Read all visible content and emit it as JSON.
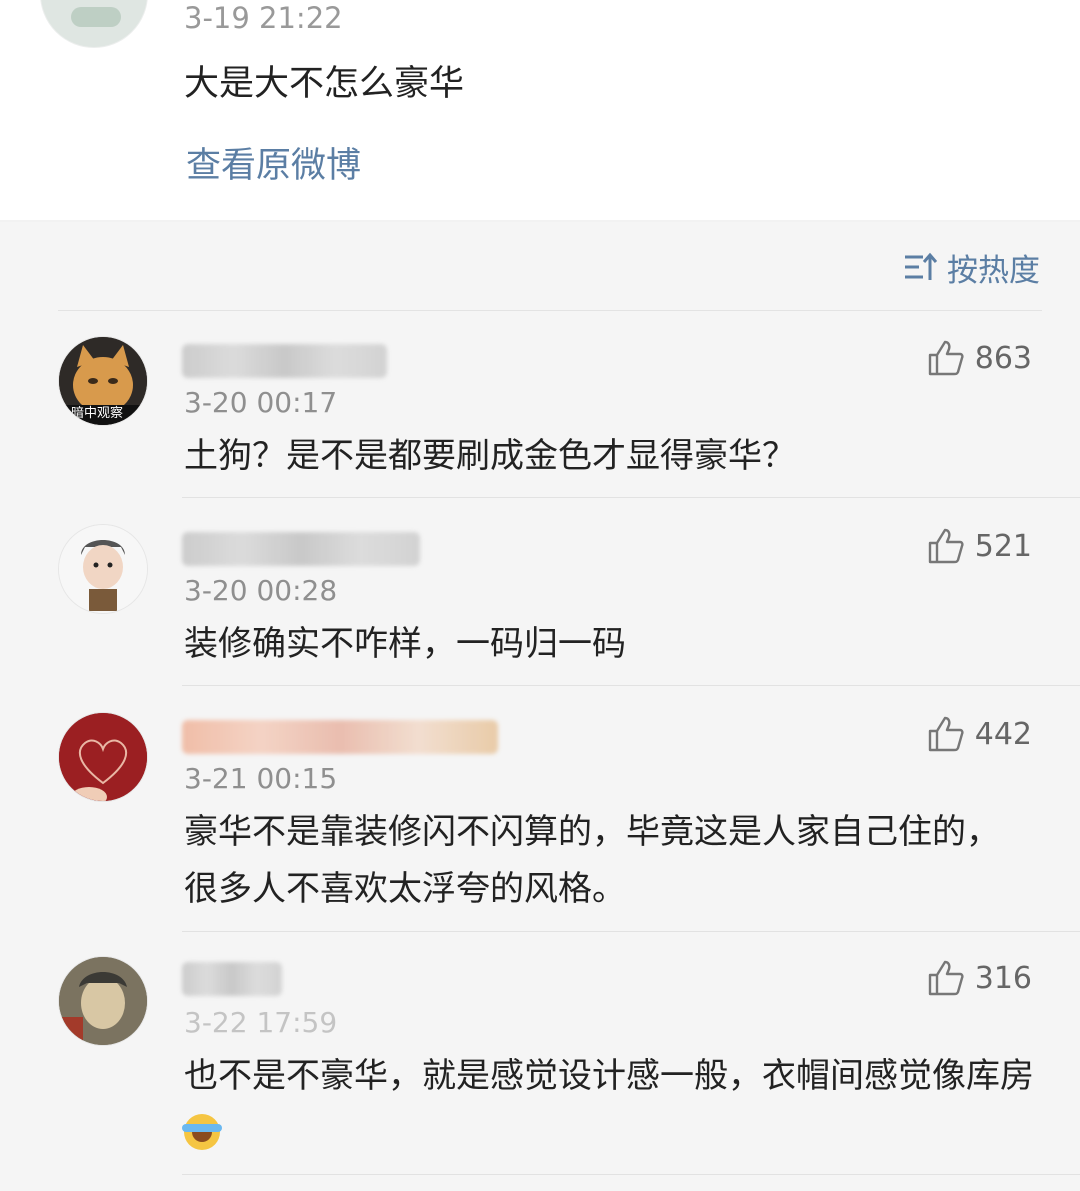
{
  "post": {
    "time": "3-19 21:22",
    "text": "大是大不怎么豪华",
    "view_original_label": "查看原微博"
  },
  "sort": {
    "label": "按热度",
    "icon": "sort-icon"
  },
  "comments": [
    {
      "time": "3-20 00:17",
      "text": "土狗？是不是都要刷成金色才显得豪华？",
      "likes": "863",
      "avatar_caption": "暗中观察"
    },
    {
      "time": "3-20 00:28",
      "text": "装修确实不咋样，一码归一码",
      "likes": "521"
    },
    {
      "time": "3-21 00:15",
      "text": "豪华不是靠装修闪不闪算的，毕竟这是人家自己住的，很多人不喜欢太浮夸的风格。",
      "likes": "442"
    },
    {
      "time": "3-22 17:59",
      "text": "也不是不豪华，就是感觉设计感一般，衣帽间感觉像库房",
      "likes": "316",
      "emoji": "laughing-crying-emoji"
    }
  ],
  "colors": {
    "link": "#5b7ea4",
    "background": "#f5f5f5"
  }
}
